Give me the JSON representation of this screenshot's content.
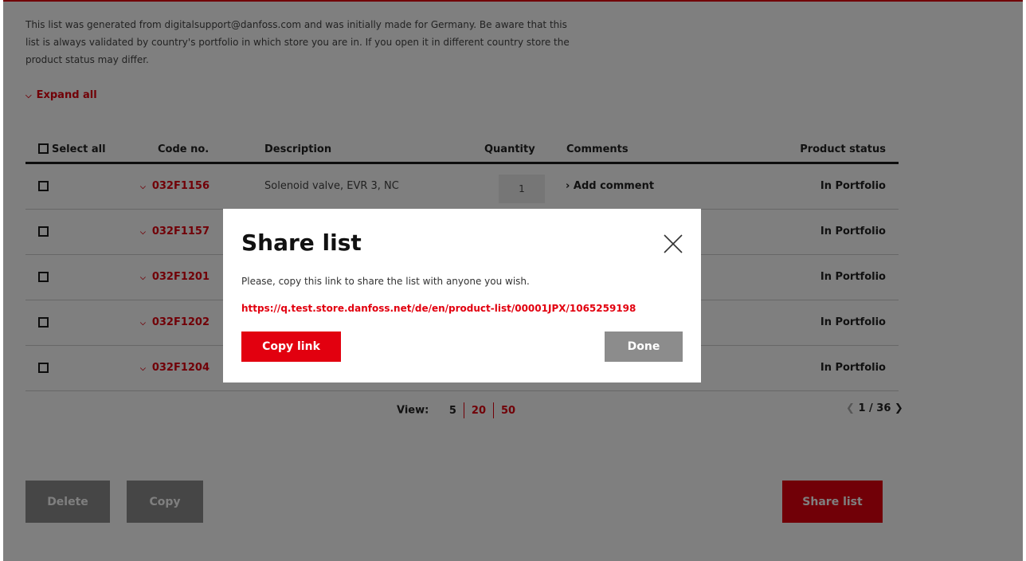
{
  "intro": {
    "text": "This list was generated from digitalsupport@danfoss.com and was initially made for Germany. Be aware that this list is always validated by country's portfolio in which store you are in. If you open it in different country store the product status may differ."
  },
  "expand_all": "Expand all",
  "table": {
    "headers": {
      "select_all": "Select all",
      "code": "Code no.",
      "description": "Description",
      "quantity": "Quantity",
      "comments": "Comments",
      "status": "Product status"
    },
    "rows": [
      {
        "code": "032F1156",
        "description": "Solenoid valve, EVR 3, NC",
        "quantity": "1",
        "comment": "› Add comment",
        "status": "In Portfolio"
      },
      {
        "code": "032F1157",
        "status": "In Portfolio"
      },
      {
        "code": "032F1201",
        "status": "In Portfolio"
      },
      {
        "code": "032F1202",
        "status": "In Portfolio"
      },
      {
        "code": "032F1204",
        "status": "In Portfolio"
      }
    ]
  },
  "pagination": {
    "view_label": "View:",
    "options": [
      "5",
      "20",
      "50"
    ],
    "page": "1 / 36"
  },
  "buttons": {
    "delete": "Delete",
    "copy": "Copy",
    "share": "Share list"
  },
  "modal": {
    "title": "Share list",
    "text": "Please, copy this link to share the list with anyone you wish.",
    "link": "https://q.test.store.danfoss.net/de/en/product-list/00001JPX/1065259198",
    "copy_link": "Copy link",
    "done": "Done"
  },
  "colors": {
    "brand_red": "#e2000f",
    "button_gray": "#8c8c8c"
  }
}
